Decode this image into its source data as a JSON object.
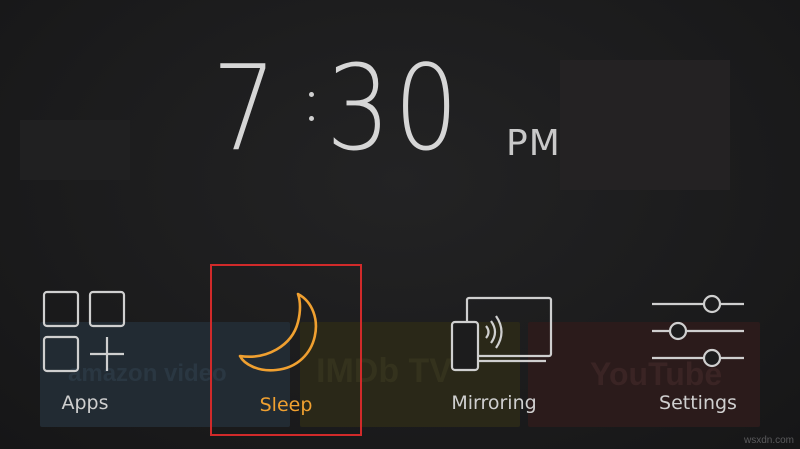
{
  "clock": {
    "hours": "7",
    "minutes": "30",
    "meridiem": "PM"
  },
  "menu": {
    "items": [
      {
        "label": "Apps",
        "icon": "apps-grid-plus-icon",
        "selected": false
      },
      {
        "label": "Sleep",
        "icon": "crescent-moon-icon",
        "selected": true
      },
      {
        "label": "Mirroring",
        "icon": "screen-mirroring-icon",
        "selected": false
      },
      {
        "label": "Settings",
        "icon": "settings-sliders-icon",
        "selected": false
      }
    ]
  },
  "background": {
    "tiles": [
      "amazon video",
      "IMDb TV",
      "YouTube"
    ]
  },
  "watermark": "wsxdn.com",
  "colors": {
    "accent": "#f0a030",
    "selection_border": "#d12a2a",
    "text": "#cfcfcf",
    "background": "#1c1c1d"
  }
}
